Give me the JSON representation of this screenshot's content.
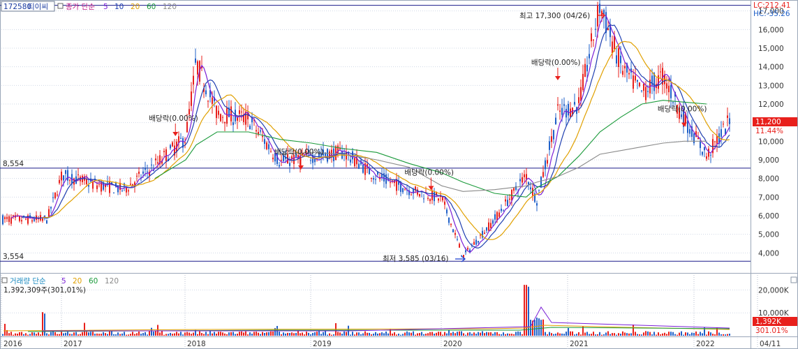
{
  "header": {
    "code": "172580",
    "name": "티이씨",
    "price_legend": {
      "label": "종가 단순",
      "periods": [
        "5",
        "10",
        "20",
        "60",
        "120"
      ]
    },
    "volume_legend": {
      "label": "거래량 단순",
      "periods": [
        "5",
        "20",
        "60",
        "120"
      ]
    },
    "volume_value": "1,392,309주(301,01%)"
  },
  "colors": {
    "up": "#e8201c",
    "down": "#2060c8",
    "ma5": "#7a1fd6",
    "ma10": "#1f3fb0",
    "ma20": "#e0a000",
    "ma60": "#1a9a3a",
    "ma120": "#8a8a8a",
    "hline": "#1a1a8a",
    "grid": "#cfd8e6"
  },
  "right_labels": {
    "lc": "LC:212.41",
    "hc": "HC:-35.26",
    "current_price": "11,200",
    "change_pct": "11.44%",
    "volume_current": "1,392K",
    "volume_pct": "301.01%"
  },
  "hlines": [
    {
      "value": 8554,
      "label": "8,554"
    },
    {
      "value": 3554,
      "label": "3,554"
    }
  ],
  "annotations": {
    "high": "최고 17,300 (04/26)",
    "low": "최저 3,585 (03/16)",
    "dividend": "배당락(0.00%)"
  },
  "x_axis": {
    "labels": [
      "2016",
      "2017",
      "2018",
      "2019",
      "2020",
      "2021",
      "2022",
      "04/11"
    ]
  },
  "chart_data": [
    {
      "type": "line",
      "title": "",
      "ylim": [
        3000,
        17400
      ],
      "y_ticks": [
        4000,
        5000,
        6000,
        7000,
        8000,
        9000,
        10000,
        11000,
        12000,
        13000,
        14000,
        15000,
        16000,
        17000
      ],
      "y_tick_labels": [
        "4,000",
        "5,000",
        "6,000",
        "7,000",
        "8,000",
        "9,000",
        "10,000",
        "11,000",
        "12,000",
        "13,000",
        "14,000",
        "15,000",
        "16,000",
        "17,000"
      ],
      "x_dates": [
        "2016-10",
        "2017-01",
        "2017-04",
        "2017-07",
        "2017-10",
        "2018-01",
        "2018-02",
        "2018-04",
        "2018-07",
        "2018-10",
        "2019-01",
        "2019-04",
        "2019-07",
        "2019-10",
        "2020-01",
        "2020-03",
        "2020-06",
        "2020-09",
        "2020-10",
        "2020-12",
        "2021-02",
        "2021-04",
        "2021-06",
        "2021-08",
        "2021-10",
        "2021-12",
        "2022-02",
        "2022-04"
      ],
      "series": [
        {
          "name": "종가",
          "values": [
            5800,
            8200,
            7700,
            7400,
            8700,
            10200,
            14200,
            11500,
            11200,
            8900,
            9200,
            9400,
            8100,
            7400,
            6900,
            3800,
            5800,
            8200,
            6800,
            11500,
            12000,
            17300,
            14000,
            12600,
            13500,
            11200,
            9200,
            11200
          ]
        },
        {
          "name": "MA60",
          "values": [
            null,
            null,
            null,
            null,
            8000,
            9000,
            9800,
            10500,
            10500,
            10100,
            9900,
            9600,
            9400,
            8800,
            8300,
            7800,
            7200,
            7000,
            7500,
            8100,
            9200,
            10500,
            11300,
            12000,
            12200,
            12100,
            12000,
            null
          ]
        },
        {
          "name": "MA120",
          "values": [
            null,
            null,
            null,
            null,
            null,
            null,
            null,
            null,
            null,
            9300,
            9400,
            9300,
            9000,
            8600,
            7600,
            7300,
            7400,
            7600,
            7800,
            8100,
            8600,
            9300,
            9500,
            9700,
            9900,
            10000,
            10000,
            null
          ]
        }
      ],
      "events": [
        {
          "label": "배당락(0.00%)",
          "date": "2017-12",
          "value": 10200
        },
        {
          "label": "배당락(0.00%)",
          "date": "2018-12",
          "value": 8400
        },
        {
          "label": "배당락(0.00%)",
          "date": "2019-12",
          "value": 7300
        },
        {
          "label": "배당락(0.00%)",
          "date": "2020-12",
          "value": 13200
        },
        {
          "label": "배당락(0.00%)",
          "date": "2021-12",
          "value": 10700
        }
      ]
    },
    {
      "type": "bar",
      "title": "",
      "ylim": [
        0,
        25000
      ],
      "y_ticks": [
        10000,
        20000
      ],
      "y_tick_labels": [
        "10,000K",
        "20,000K"
      ]
    }
  ]
}
